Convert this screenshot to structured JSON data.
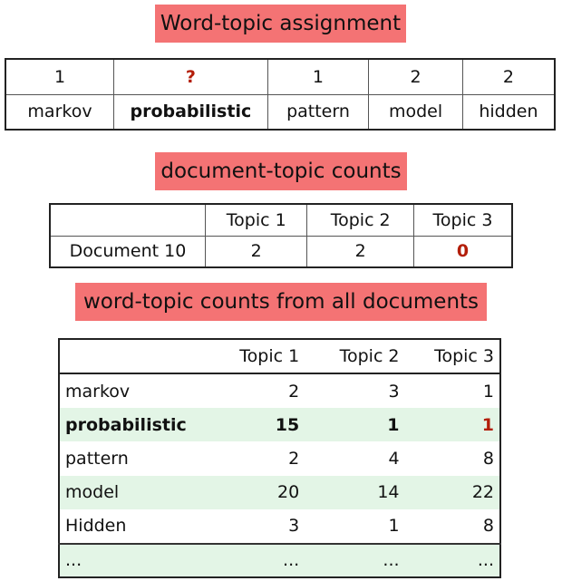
{
  "banners": {
    "word_topic_assignment": "Word-topic assignment",
    "document_topic_counts": "document-topic counts",
    "word_topic_counts": "word-topic counts from all documents"
  },
  "assignment": {
    "topics": [
      "1",
      "?",
      "1",
      "2",
      "2"
    ],
    "words": [
      "markov",
      "probabilistic",
      "pattern",
      "model",
      "hidden"
    ]
  },
  "doc_counts": {
    "headers": [
      "Topic 1",
      "Topic 2",
      "Topic 3"
    ],
    "row_label": "Document 10",
    "values": [
      "2",
      "2",
      "0"
    ]
  },
  "word_counts": {
    "headers": [
      "Topic 1",
      "Topic 2",
      "Topic 3"
    ],
    "rows": [
      {
        "word": "markov",
        "values": [
          "2",
          "3",
          "1"
        ]
      },
      {
        "word": "probabilistic",
        "values": [
          "15",
          "1",
          "1"
        ]
      },
      {
        "word": "pattern",
        "values": [
          "2",
          "4",
          "8"
        ]
      },
      {
        "word": "model",
        "values": [
          "20",
          "14",
          "22"
        ]
      },
      {
        "word": "Hidden",
        "values": [
          "3",
          "1",
          "8"
        ]
      },
      {
        "word": "...",
        "values": [
          "...",
          "...",
          "..."
        ]
      }
    ]
  },
  "colors": {
    "banner": "#f47374",
    "highlight_text": "#b31e0a",
    "row_shade": "#e3f5e6"
  }
}
